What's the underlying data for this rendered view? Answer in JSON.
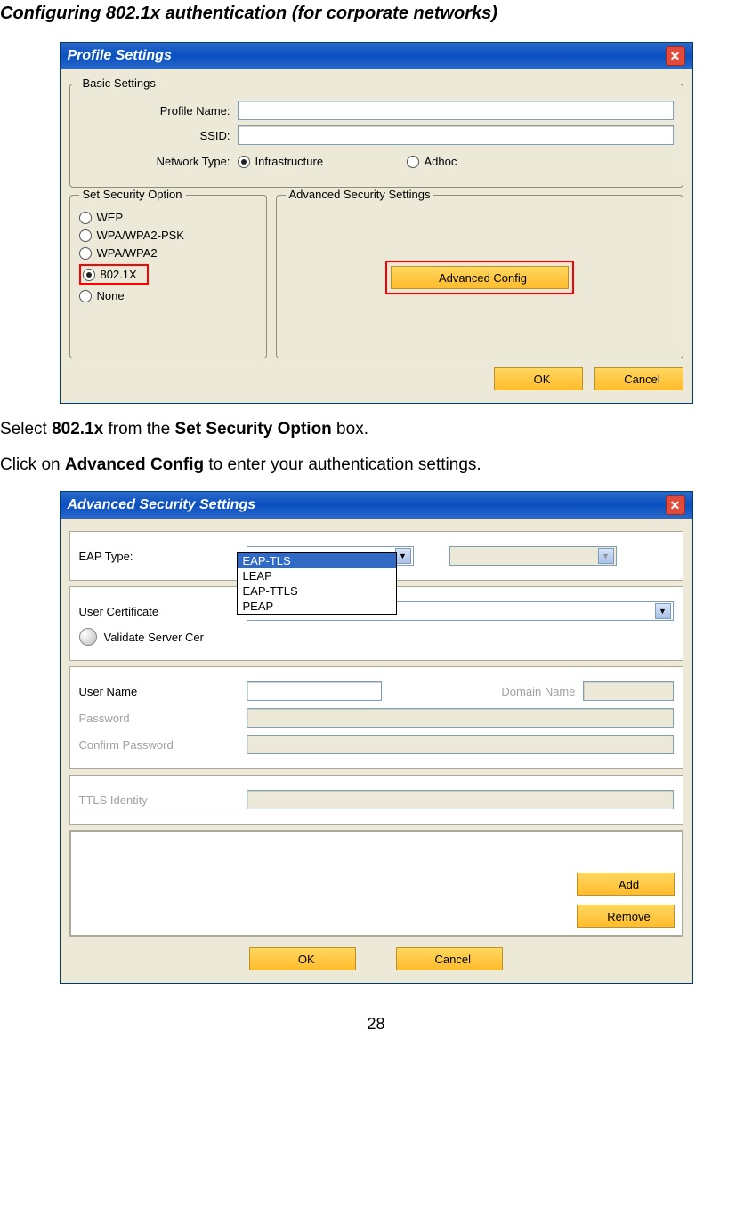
{
  "page": {
    "heading": "Configuring 802.1x authentication (for corporate networks)",
    "instruction1_pre": "Select ",
    "instruction1_b1": "802.1x",
    "instruction1_mid": " from the ",
    "instruction1_b2": "Set Security Option",
    "instruction1_post": " box.",
    "instruction2_pre": "Click on ",
    "instruction2_b1": "Advanced Config",
    "instruction2_post": " to enter your authentication settings.",
    "page_number": "28"
  },
  "dialog1": {
    "title": "Profile Settings",
    "basic": {
      "legend": "Basic Settings",
      "profile_name_label": "Profile Name:",
      "ssid_label": "SSID:",
      "network_type_label": "Network Type:",
      "infrastructure": "Infrastructure",
      "adhoc": "Adhoc"
    },
    "security": {
      "legend": "Set Security Option",
      "options": {
        "wep": "WEP",
        "wpa_psk": "WPA/WPA2-PSK",
        "wpa": "WPA/WPA2",
        "dot1x": "802.1X",
        "none": "None"
      }
    },
    "advanced": {
      "legend": "Advanced Security Settings",
      "button": "Advanced Config"
    },
    "buttons": {
      "ok": "OK",
      "cancel": "Cancel"
    }
  },
  "dialog2": {
    "title": "Advanced Security Settings",
    "eap_type_label": "EAP Type:",
    "eap_type_value": "EAP-TLS",
    "eap_options": {
      "o1": "EAP-TLS",
      "o2": "LEAP",
      "o3": "EAP-TTLS",
      "o4": "PEAP"
    },
    "user_cert_label": "User Certificate",
    "validate_label": "Validate Server Cer",
    "user_name_label": "User Name",
    "domain_name_label": "Domain Name",
    "password_label": "Password",
    "confirm_password_label": "Confirm Password",
    "ttls_identity_label": "TTLS Identity",
    "buttons": {
      "add": "Add",
      "remove": "Remove",
      "ok": "OK",
      "cancel": "Cancel"
    }
  }
}
